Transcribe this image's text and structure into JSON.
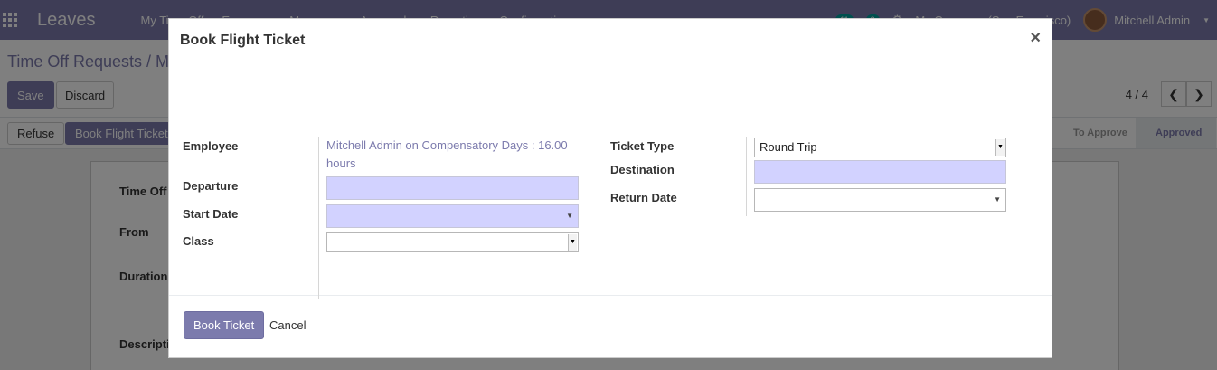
{
  "app": {
    "brand": "Leaves",
    "menu": [
      "My Time Off",
      "Everyone",
      "Managers",
      "Approvals",
      "Reporting",
      "Configuration"
    ],
    "badges": [
      "11",
      "3"
    ],
    "company": "My Company (San Francisco)",
    "user": "Mitchell Admin"
  },
  "control_panel": {
    "breadcrumb": "Time Off Requests / M",
    "save_label": "Save",
    "discard_label": "Discard",
    "pager": "4 / 4"
  },
  "statusbar": {
    "refuse_label": "Refuse",
    "book_label": "Book Flight Ticket",
    "stages": [
      "To Approve",
      "Approved"
    ]
  },
  "sheet": {
    "labels": [
      "Time Off",
      "From",
      "Duration",
      "Description"
    ]
  },
  "modal": {
    "title": "Book Flight Ticket",
    "close": "×",
    "left": {
      "employee_label": "Employee",
      "employee_value": "Mitchell Admin on Compensatory Days : 16.00 hours",
      "departure_label": "Departure",
      "start_date_label": "Start Date",
      "class_label": "Class"
    },
    "right": {
      "ticket_type_label": "Ticket Type",
      "ticket_type_value": "Round Trip",
      "destination_label": "Destination",
      "return_date_label": "Return Date"
    },
    "footer": {
      "book_ticket": "Book Ticket",
      "cancel": "Cancel"
    }
  },
  "colors": {
    "brand": "#7c7bad",
    "required_field": "#d2d2ff"
  }
}
